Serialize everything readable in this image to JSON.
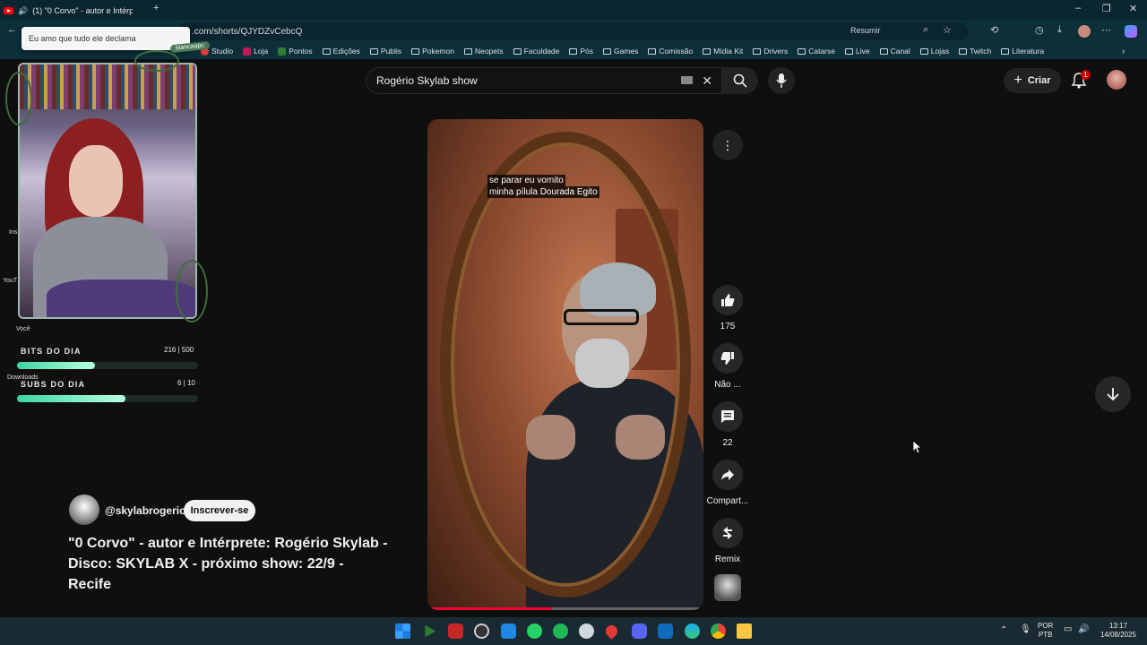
{
  "browser": {
    "tab_title": "(1) \"0 Corvo\" - autor e Intérp",
    "url": ".com/shorts/QJYDZvCebcQ",
    "summarize": "Resumir",
    "bookmarks": [
      "Studio",
      "Loja",
      "Pontos",
      "Edições",
      "Publis",
      "Pokemon",
      "Neopets",
      "Faculdade",
      "Pós",
      "Games",
      "Comissão",
      "Mídia Kit",
      "Drivers",
      "Catarse",
      "Live",
      "Canal",
      "Lojas",
      "Twitch",
      "Literatura"
    ]
  },
  "overlay": {
    "chat_message": "Eu amo que tudo ele declama",
    "chat_user": "biancaapc",
    "side_labels": [
      "Você",
      "Downloads",
      "YouT",
      "Ins"
    ],
    "bits_label": "BITS DO DIA",
    "bits_value": "216 | 500",
    "bits_progress": 0.432,
    "subs_label": "SUBS DO DIA",
    "subs_value": "6 | 10",
    "subs_progress": 0.6
  },
  "youtube": {
    "search_query": "Rogério Skylab show",
    "create_label": "Criar",
    "notification_count": "1",
    "subtitle_line1": "se parar eu vomito",
    "subtitle_line2": "minha pílula Dourada Egito",
    "video_progress": 0.45,
    "actions": {
      "like_count": "175",
      "dislike_label": "Não ...",
      "comments_count": "22",
      "share_label": "Compart...",
      "remix_label": "Remix"
    },
    "channel_handle": "@skylabrogerio",
    "subscribe_label": "Inscrever-se",
    "video_title": "\"0 Corvo\" - autor e Intérprete: Rogério Skylab - Disco: SKYLAB X - próximo show: 22/9 - Recife"
  },
  "taskbar": {
    "lang_top": "POR",
    "lang_bottom": "PTB",
    "time": "13:17",
    "date": "14/08/2025"
  }
}
